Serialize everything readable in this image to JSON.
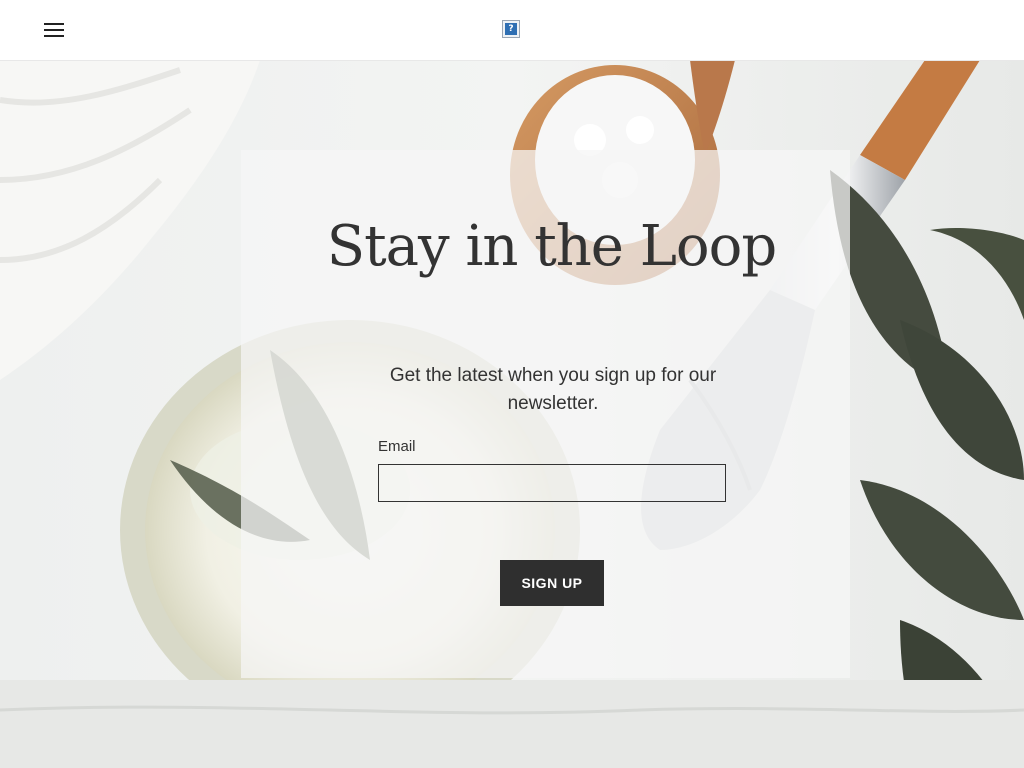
{
  "header": {
    "menu_icon": "hamburger-menu-icon",
    "logo_icon": "site-logo-icon",
    "logo_glyph": "?"
  },
  "hero": {
    "background": "spa products: towel, bowl of white cream, wooden spoon with bath salt, makeup brush, sage leaves"
  },
  "newsletter": {
    "title": "Stay in the Loop",
    "subtitle": "Get the latest when you sign up for our newsletter.",
    "email_label": "Email",
    "email_value": "",
    "email_placeholder": "",
    "button_label": "SIGN UP"
  },
  "colors": {
    "text": "#333333",
    "button_bg": "#2f2f2f",
    "button_text": "#ffffff",
    "card_bg": "rgba(245,246,246,0.74)"
  }
}
